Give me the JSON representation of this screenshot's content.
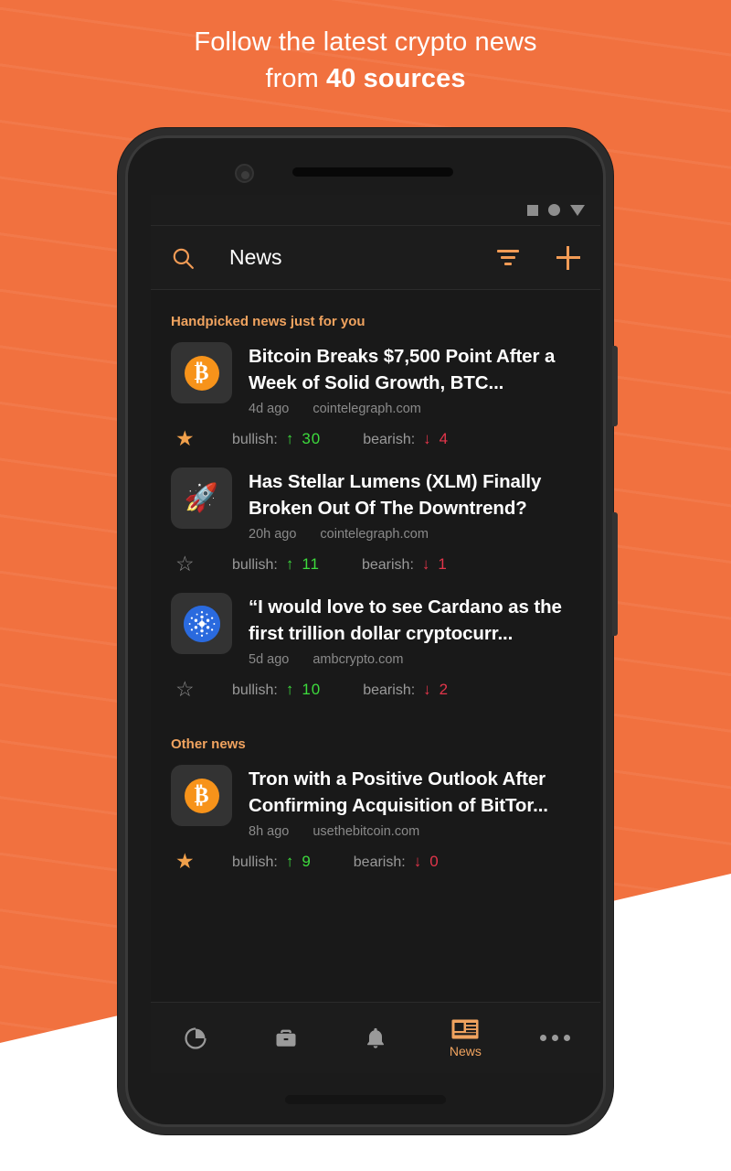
{
  "promo": {
    "line1": "Follow the latest crypto news",
    "line2_prefix": "from ",
    "line2_strong": "40 sources"
  },
  "colors": {
    "background_orange": "#f1713f",
    "accent_orange": "#f0a35f",
    "bullish_green": "#3ddb3d",
    "bearish_red": "#e2354a",
    "screen_dark": "#191919",
    "bar_dark": "#1c1c1c"
  },
  "statusbar": {
    "icons": [
      "square-icon",
      "circle-icon",
      "triangle-down-icon"
    ]
  },
  "appbar": {
    "search_icon": "search-icon",
    "title": "News",
    "filter_icon": "filter-icon",
    "add_icon": "plus-icon"
  },
  "sections": [
    {
      "title": "Handpicked news just for you",
      "items": [
        {
          "icon": "bitcoin-icon",
          "title": "Bitcoin Breaks $7,500 Point After a Week of Solid Growth, BTC...",
          "age": "4d ago",
          "source": "cointelegraph.com",
          "starred": true,
          "star_glyph": "★",
          "bullish_label": "bullish:",
          "bullish_arrow": "↑",
          "bullish_count": "30",
          "bearish_label": "bearish:",
          "bearish_arrow": "↓",
          "bearish_count": "4"
        },
        {
          "icon": "rocket-icon",
          "title": "Has Stellar Lumens (XLM) Finally Broken Out Of The Downtrend?",
          "age": "20h ago",
          "source": "cointelegraph.com",
          "starred": false,
          "star_glyph": "☆",
          "bullish_label": "bullish:",
          "bullish_arrow": "↑",
          "bullish_count": "11",
          "bearish_label": "bearish:",
          "bearish_arrow": "↓",
          "bearish_count": "1"
        },
        {
          "icon": "cardano-icon",
          "title": "“I would love to see Cardano as the first trillion dollar cryptocurr...",
          "age": "5d ago",
          "source": "ambcrypto.com",
          "starred": false,
          "star_glyph": "☆",
          "bullish_label": "bullish:",
          "bullish_arrow": "↑",
          "bullish_count": "10",
          "bearish_label": "bearish:",
          "bearish_arrow": "↓",
          "bearish_count": "2"
        }
      ]
    },
    {
      "title": "Other news",
      "items": [
        {
          "icon": "bitcoin-icon",
          "title": "Tron with a Positive Outlook After Confirming Acquisition of BitTor...",
          "age": "8h ago",
          "source": "usethebitcoin.com",
          "starred": true,
          "star_glyph": "★",
          "bullish_label": "bullish:",
          "bullish_arrow": "↑",
          "bullish_count": "9",
          "bearish_label": "bearish:",
          "bearish_arrow": "↓",
          "bearish_count": "0"
        }
      ]
    }
  ],
  "bottom_nav": [
    {
      "icon": "pie-chart-icon",
      "label": "",
      "active": false
    },
    {
      "icon": "briefcase-icon",
      "label": "",
      "active": false
    },
    {
      "icon": "bell-icon",
      "label": "",
      "active": false
    },
    {
      "icon": "news-icon",
      "label": "News",
      "active": true
    },
    {
      "icon": "more-dots-icon",
      "label": "",
      "active": false
    }
  ]
}
